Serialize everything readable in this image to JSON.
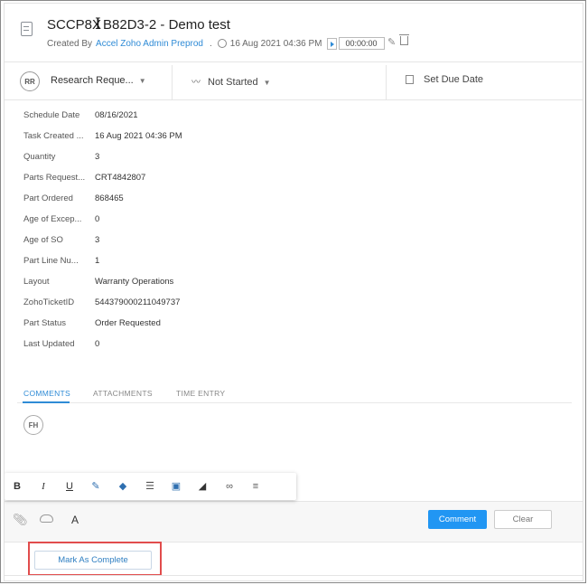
{
  "header": {
    "title": "SCCP8X",
    "title_rest": "B82D3-2 - Demo test",
    "created_by_label": "Created By",
    "creator": "Accel Zoho Admin Preprod",
    "created_at": "16 Aug 2021 04:36 PM",
    "timer": "00:00:00"
  },
  "status_row": {
    "owner_initials": "RR",
    "owner": "Research Reque...",
    "status": "Not Started",
    "due_date_label": "Set Due Date"
  },
  "fields": [
    {
      "label": "Schedule Date",
      "value": "08/16/2021"
    },
    {
      "label": "Task Created ...",
      "value": "16 Aug 2021 04:36 PM"
    },
    {
      "label": "Quantity",
      "value": "3"
    },
    {
      "label": "Parts Request...",
      "value": "CRT4842807"
    },
    {
      "label": "Part Ordered",
      "value": "868465"
    },
    {
      "label": "Age of Excep...",
      "value": "0"
    },
    {
      "label": "Age of SO",
      "value": "3"
    },
    {
      "label": "Part Line Nu...",
      "value": "1"
    },
    {
      "label": "Layout",
      "value": "Warranty Operations"
    },
    {
      "label": "ZohoTicketID",
      "value": "544379000211049737"
    },
    {
      "label": "Part Status",
      "value": "Order Requested"
    },
    {
      "label": "Last Updated",
      "value": "0"
    }
  ],
  "tabs": [
    "COMMENTS",
    "ATTACHMENTS",
    "TIME ENTRY"
  ],
  "comment_avatar": "FH",
  "toolbar": {
    "bold": "B",
    "italic": "I",
    "underline": "U",
    "font_label": "A",
    "comment_button": "Comment",
    "clear_button": "Clear"
  },
  "footer": {
    "complete_button": "Mark As Complete"
  },
  "colors": {
    "accent": "#2196f3",
    "highlight": "#e14c4c"
  }
}
